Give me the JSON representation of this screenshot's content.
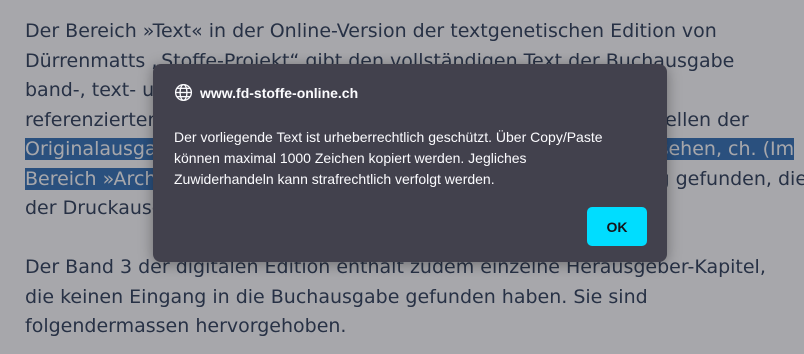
{
  "document": {
    "paragraph1": {
      "line1": "Der Bereich »Text« in der Online-Version der textgenetischen Edition von",
      "line2": "Dürrenmatts „Stoffe-Projekt“ gibt den vollständigen Text der Buchausgabe",
      "line3": "band-, text- und seitengenau wieder. In der Online-Version sind alle",
      "line4": "referenzierten Textstellen mit Verweisen auf die entsprechenden Stellen der",
      "line5_highlight": "Originalausgabe versehen und mit Anmerkungen kommentiert versehen, ch. (Im",
      "line6_highlight": "Bereich »Archiv«",
      "line6_rest": " finden Sie diejenigen Textteile, die keinen Eingang gefunden, die in",
      "line7": "der Druckausgabe nicht berücksichtigt wurden.)"
    },
    "paragraph2": {
      "line1": "Der Band 3 der digitalen Edition enthält zudem einzelne Herausgeber-Kapitel,",
      "line2": "die keinen Eingang in die Buchausgabe gefunden haben. Sie sind",
      "line3": "folgendermassen hervorgehoben."
    },
    "highlight_color": "#2f6fb5",
    "text_color": "#2b3b55"
  },
  "dialog": {
    "site": "www.fd-stoffe-online.ch",
    "site_icon": "globe-icon",
    "message_line1": "Der vorliegende Text ist urheberrechtlich geschützt. Über Copy/Paste",
    "message_line2": "können maximal 1000 Zeichen kopiert werden. Jegliches",
    "message_line3": "Zuwiderhandeln kann strafrechtlich verfolgt werden.",
    "ok_label": "OK",
    "background_color": "#42414d",
    "button_color": "#00ddff"
  }
}
